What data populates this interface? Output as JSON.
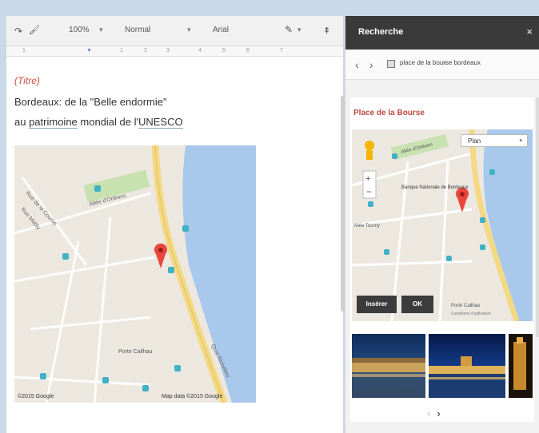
{
  "toolbar": {
    "zoom": "100%",
    "style": "Normal",
    "font": "Arial"
  },
  "ruler": [
    "1",
    "1",
    "2",
    "3",
    "4",
    "5",
    "6",
    "7"
  ],
  "document": {
    "title_placeholder": "(Titre)",
    "line1": "Bordeaux: de la \"Belle endormie\"",
    "line2_a": "au ",
    "line2_b": "patrimoine",
    "line2_c": " mondial de l'",
    "line2_d": "UNESCO",
    "map": {
      "label_orleans": "Allée d'Orléans",
      "label_street1": "Rue de la Course",
      "label_street2": "Rue Mably",
      "label_cailhau": "Porte Cailhau",
      "label_quai": "Quai Richelieu",
      "copyright": "©2015 Google",
      "mapdata": "Map data ©2015 Google"
    }
  },
  "panel": {
    "title": "Recherche",
    "close": "×",
    "back": "‹",
    "forward": "›",
    "query": "place de la bourse bordeaux",
    "result_title": "Place de la Bourse",
    "map": {
      "type_select": "Plan",
      "label_orleans": "Allée d'Orléans",
      "label_bank": "Banque Nationale de Bordeaux",
      "label_tourny": "Allée Tourny",
      "label_cailhau": "Porte Cailhau",
      "terms": "Conditions d'utilisation",
      "insert_button": "Insérer",
      "ok_button": "OK"
    },
    "pager_prev": "‹",
    "pager_next": "›"
  },
  "colors": {
    "accent_red": "#d04b3f",
    "river": "#a8c8ec",
    "road_yellow": "#f4d985",
    "park_green": "#c8e1b0",
    "panel_header": "#3a3a3a"
  }
}
